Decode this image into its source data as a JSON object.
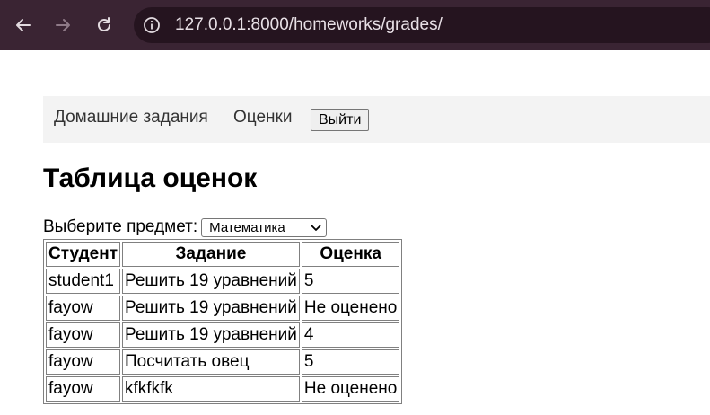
{
  "browser": {
    "url": "127.0.0.1:8000/homeworks/grades/"
  },
  "nav": {
    "homeworks_label": "Домашние задания",
    "grades_label": "Оценки",
    "logout_label": "Выйти"
  },
  "page": {
    "title": "Таблица оценок",
    "subject_label": "Выберите предмет:",
    "subject_selected": "Математика"
  },
  "table": {
    "headers": [
      "Студент",
      "Задание",
      "Оценка"
    ],
    "rows": [
      [
        "student1",
        "Решить 19 уравнений",
        "5"
      ],
      [
        "fayow",
        "Решить 19 уравнений",
        "Не оценено"
      ],
      [
        "fayow",
        "Решить 19 уравнений",
        "4"
      ],
      [
        "fayow",
        "Посчитать овец",
        "5"
      ],
      [
        "fayow",
        "kfkfkfk",
        "Не оценено"
      ]
    ]
  },
  "colors": {
    "chrome_bg": "#3a2433",
    "address_bg": "#25141f",
    "navbar_bg": "#f3f3f3"
  },
  "icons": [
    "back-arrow-icon",
    "forward-arrow-icon",
    "reload-icon",
    "info-icon",
    "chevron-down-icon"
  ]
}
